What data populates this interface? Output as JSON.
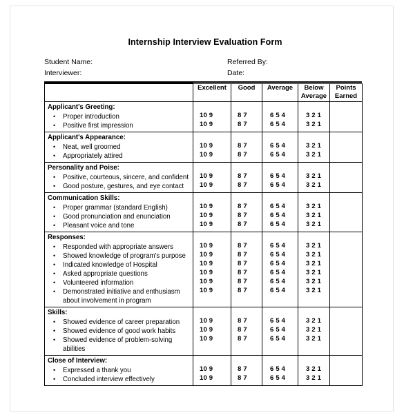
{
  "document": {
    "title": "Internship Interview Evaluation Form",
    "fields": [
      {
        "label_left": "Student Name:",
        "label_right": "Referred By:"
      },
      {
        "label_left": "Interviewer:",
        "label_right": "Date:"
      }
    ]
  },
  "table": {
    "headers": [
      "",
      "Excellent",
      "Good",
      "Average",
      "Below Average",
      "Points Earned"
    ],
    "scale": {
      "excellent": "10  9",
      "good": "8  7",
      "average": "6  5  4",
      "below_average": "3  2  1"
    },
    "sections": [
      {
        "heading": "Applicant's  Greeting:",
        "items": [
          {
            "text": "Proper introduction"
          },
          {
            "text": "Positive first impression"
          }
        ],
        "lead_blank": false
      },
      {
        "heading": "Applicant's Appearance:",
        "items": [
          {
            "text": "Neat, well groomed"
          },
          {
            "text": "Appropriately attired"
          }
        ],
        "lead_blank": false
      },
      {
        "heading": "Personality and Poise:",
        "items": [
          {
            "text": "Positive, courteous, sincere, and confident"
          },
          {
            "text": "Good posture, gestures, and eye contact"
          }
        ],
        "lead_blank": false
      },
      {
        "heading": "Communication Skills:",
        "items": [
          {
            "text": "Proper grammar (standard English)"
          },
          {
            "text": "Good pronunciation and enunciation"
          },
          {
            "text": "Pleasant voice and tone"
          }
        ],
        "lead_blank": false
      },
      {
        "heading": "Responses:",
        "items": [
          {
            "text": "Responded with appropriate answers"
          },
          {
            "text": "Showed knowledge of program's purpose"
          },
          {
            "text": "Indicated knowledge of Hospital"
          },
          {
            "text": "Asked appropriate questions"
          },
          {
            "text": "Volunteered information"
          },
          {
            "text": "Demonstrated initiative and enthusiasm",
            "cont": "about involvement in program"
          }
        ],
        "lead_blank": false
      },
      {
        "heading": "Skills:",
        "items": [
          {
            "text": "Showed evidence of career preparation"
          },
          {
            "text": "Showed evidence of good work habits"
          },
          {
            "text": "Showed evidence of problem-solving",
            "cont": "abilities"
          }
        ],
        "lead_blank": false
      },
      {
        "heading": "Close of Interview:",
        "items": [
          {
            "text": "Expressed a thank you"
          },
          {
            "text": "Concluded interview effectively"
          }
        ],
        "lead_blank": false
      }
    ]
  },
  "symbols": {
    "bullet": "•"
  }
}
